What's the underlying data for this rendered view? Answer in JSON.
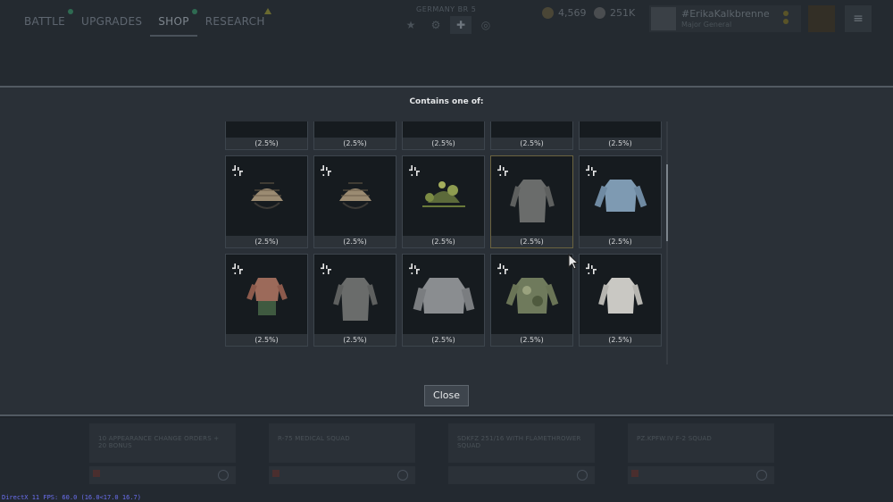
{
  "nav": {
    "items": [
      "BATTLE",
      "UPGRADES",
      "SHOP",
      "RESEARCH"
    ],
    "active": "SHOP"
  },
  "nation": {
    "label": "GERMANY BR 5"
  },
  "currency": {
    "gold": "4,569",
    "silver": "251K"
  },
  "profile": {
    "name": "#ErikaKalkbrenne",
    "rank": "Major General"
  },
  "modal": {
    "title": "Contains one of:",
    "close_label": "Close"
  },
  "items": [
    {
      "chance": "(2.5%)",
      "kind": "hat"
    },
    {
      "chance": "(2.5%)",
      "kind": "helmet-band"
    },
    {
      "chance": "(2.5%)",
      "kind": "helmet-grass"
    },
    {
      "chance": "(2.5%)",
      "kind": "helmet-strap"
    },
    {
      "chance": "(2.5%)",
      "kind": "helmet-cloth"
    },
    {
      "chance": "(2.5%)",
      "kind": "helmet-net"
    },
    {
      "chance": "(2.5%)",
      "kind": "helmet-net"
    },
    {
      "chance": "(2.5%)",
      "kind": "helmet-foliage"
    },
    {
      "chance": "(2.5%)",
      "kind": "greatcoat-grey",
      "selected": true
    },
    {
      "chance": "(2.5%)",
      "kind": "tunic-blue"
    },
    {
      "chance": "(2.5%)",
      "kind": "tunic-rust"
    },
    {
      "chance": "(2.5%)",
      "kind": "greatcoat-grey"
    },
    {
      "chance": "(2.5%)",
      "kind": "jacket-padded"
    },
    {
      "chance": "(2.5%)",
      "kind": "smock-camo"
    },
    {
      "chance": "(2.5%)",
      "kind": "tunic-white"
    }
  ],
  "offers": [
    "10 APPEARANCE CHANGE ORDERS + 20 BONUS",
    "R-75 MEDICAL SQUAD",
    "SDKFZ 251/16 WITH FLAMETHROWER SQUAD",
    "PZ.KPFW.IV F-2 SQUAD"
  ],
  "fps_text": "DirectX 11 FPS: 60.0 (16.0<17.0 16.7)",
  "colors": {
    "modal_bg": "#2a3037",
    "card_bg": "#1a1f24",
    "card_border": "#3d454d",
    "selected_border": "#6b6340",
    "fps": "#6b6ff0"
  }
}
